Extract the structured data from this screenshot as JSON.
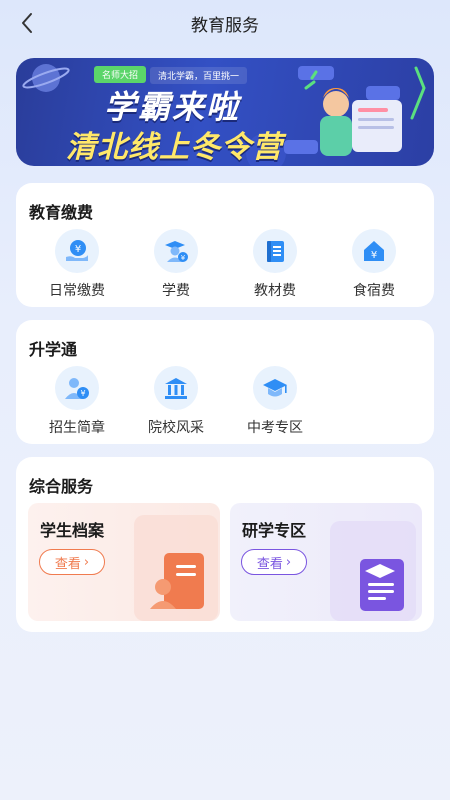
{
  "header": {
    "title": "教育服务"
  },
  "banner": {
    "tag": "名师大招",
    "subtitle": "清北学霸，百里挑一",
    "headline": "学霸来啦",
    "headline2": "清北线上冬令营"
  },
  "education_payment": {
    "title": "教育缴费",
    "items": [
      {
        "label": "日常缴费",
        "icon": "hand-yuan-icon"
      },
      {
        "label": "学费",
        "icon": "student-yuan-icon"
      },
      {
        "label": "教材费",
        "icon": "book-icon"
      },
      {
        "label": "食宿费",
        "icon": "house-yuan-icon"
      }
    ]
  },
  "admission": {
    "title": "升学通",
    "items": [
      {
        "label": "招生简章",
        "icon": "person-yuan-icon"
      },
      {
        "label": "院校风采",
        "icon": "building-icon"
      },
      {
        "label": "中考专区",
        "icon": "graduation-cap-icon"
      }
    ]
  },
  "services": {
    "title": "综合服务",
    "cards": [
      {
        "name": "学生档案",
        "button": "查看",
        "accent": "#f07b4f"
      },
      {
        "name": "研学专区",
        "button": "查看",
        "accent": "#7a55e0"
      }
    ]
  },
  "colors": {
    "icon_blue": "#2f8ef5",
    "icon_bg": "#e8f2fd"
  }
}
